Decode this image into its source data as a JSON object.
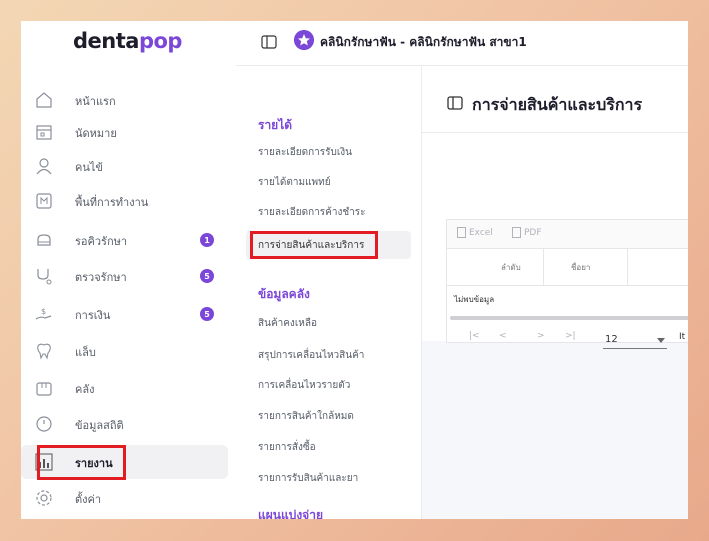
{
  "logo": {
    "part1": "denta",
    "part2": "pop"
  },
  "topbar": {
    "clinic_title": "คลินิกรักษาฟัน - คลินิกรักษาฟัน สาขา1"
  },
  "nav": {
    "items": [
      {
        "label": "หน้าแรก",
        "icon": "home-icon"
      },
      {
        "label": "นัดหมาย",
        "icon": "calendar-icon"
      },
      {
        "label": "คนไข้",
        "icon": "user-icon"
      },
      {
        "label": "พื้นที่การทำงาน",
        "icon": "workspace-icon"
      },
      {
        "label": "รอคิวรักษา",
        "icon": "dental-chair-icon",
        "badge": "1"
      },
      {
        "label": "ตรวจรักษา",
        "icon": "treatment-icon",
        "badge": "5"
      },
      {
        "label": "การเงิน",
        "icon": "money-icon",
        "badge": "5"
      },
      {
        "label": "แล็บ",
        "icon": "tooth-icon"
      },
      {
        "label": "คลัง",
        "icon": "box-icon"
      },
      {
        "label": "ข้อมูลสถิติ",
        "icon": "clock-icon"
      },
      {
        "label": "รายงาน",
        "icon": "report-icon",
        "active": true
      },
      {
        "label": "ตั้งค่า",
        "icon": "gear-icon"
      }
    ]
  },
  "subnav": {
    "section1": "รายได้",
    "section1_items": [
      "รายละเอียดการรับเงิน",
      "รายได้ตามแพทย์",
      "รายละเอียดการค้างชำระ",
      "การจ่ายสินค้าและบริการ"
    ],
    "section2": "ข้อมูลคลัง",
    "section2_items": [
      "สินค้าคงเหลือ",
      "สรุปการเคลื่อนไหวสินค้า",
      "การเคลื่อนไหวรายตัว",
      "รายการสินค้าใกล้หมด",
      "รายการสั่งซื้อ",
      "รายการรับสินค้าและยา"
    ],
    "section3": "แผนแบ่งจ่าย"
  },
  "main": {
    "title": "การจ่ายสินค้าและบริการ",
    "toolbar": {
      "excel": "Excel",
      "pdf": "PDF"
    },
    "columns": [
      "ลำดับ",
      "ชื่อยา"
    ],
    "no_data": "ไม่พบข้อมูล",
    "pager": {
      "first": "|<",
      "prev": "<",
      "next": ">",
      "last": ">|",
      "page_size": "12",
      "items_label": "It"
    }
  },
  "colors": {
    "accent": "#7b47d8",
    "highlight": "#e31b23"
  }
}
